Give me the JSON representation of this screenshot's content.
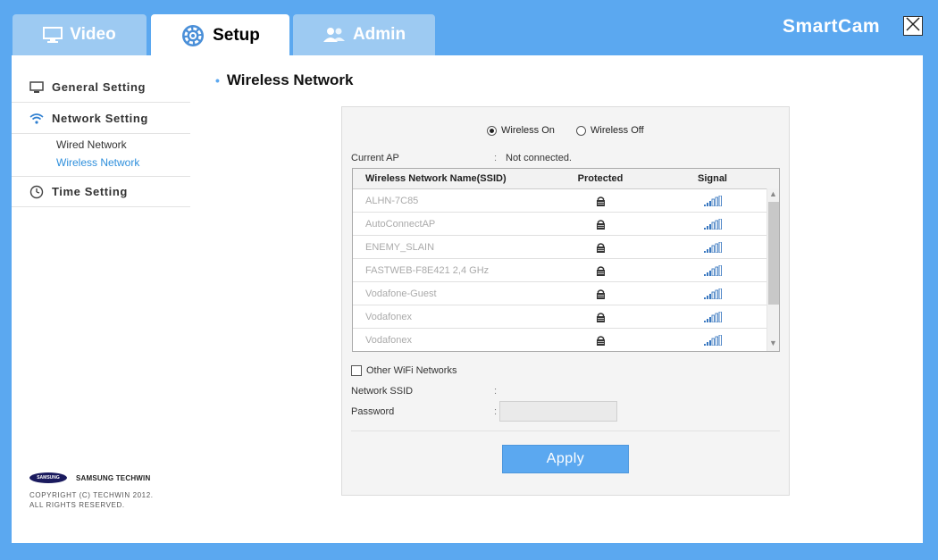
{
  "tabs": {
    "video": "Video",
    "setup": "Setup",
    "admin": "Admin"
  },
  "app": {
    "logo": "SmartCam"
  },
  "sidebar": {
    "general": "General Setting",
    "network": "Network Setting",
    "wired": "Wired Network",
    "wireless": "Wireless Network",
    "time": "Time Setting",
    "brand": "SAMSUNG TECHWIN",
    "brand_logo": "SAMSUNG",
    "copyright1": "COPYRIGHT (C) TECHWIN 2012.",
    "copyright2": "ALL RIGHTS RESERVED."
  },
  "page": {
    "title": "Wireless Network"
  },
  "wireless": {
    "on_label": "Wireless On",
    "off_label": "Wireless Off",
    "selected": "on",
    "current_ap_label": "Current AP",
    "current_ap_value": "Not connected.",
    "headers": {
      "ssid": "Wireless Network Name(SSID)",
      "protected": "Protected",
      "signal": "Signal"
    },
    "networks": [
      {
        "ssid": "ALHN-7C85"
      },
      {
        "ssid": "AutoConnectAP"
      },
      {
        "ssid": "ENEMY_SLAIN"
      },
      {
        "ssid": "FASTWEB-F8E421 2,4 GHz"
      },
      {
        "ssid": "Vodafone-Guest"
      },
      {
        "ssid": "Vodafonex"
      },
      {
        "ssid": "Vodafonex"
      }
    ],
    "other_label": "Other WiFi Networks",
    "ssid_label": "Network SSID",
    "password_label": "Password",
    "colon": ":",
    "apply_label": "Apply"
  },
  "colors": {
    "accent": "#5ba8f0",
    "active_link": "#2e8fdc"
  }
}
